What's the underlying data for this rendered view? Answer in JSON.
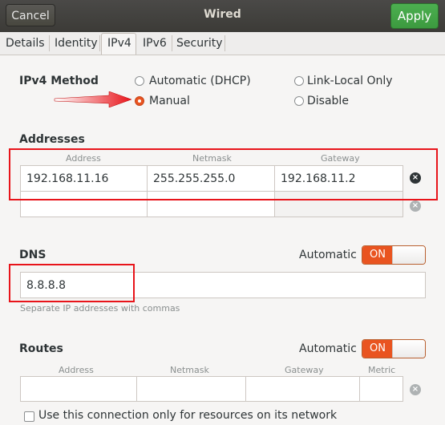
{
  "window": {
    "title": "Wired",
    "cancel_label": "Cancel",
    "apply_label": "Apply"
  },
  "tabs": [
    {
      "label": "Details"
    },
    {
      "label": "Identity"
    },
    {
      "label": "IPv4"
    },
    {
      "label": "IPv6"
    },
    {
      "label": "Security"
    }
  ],
  "active_tab": "IPv4",
  "ipv4_method": {
    "label": "IPv4 Method",
    "options": [
      "Automatic (DHCP)",
      "Link-Local Only",
      "Manual",
      "Disable"
    ],
    "selected": "Manual"
  },
  "addresses": {
    "section_label": "Addresses",
    "columns": [
      "Address",
      "Netmask",
      "Gateway"
    ],
    "rows": [
      {
        "address": "192.168.11.16",
        "netmask": "255.255.255.0",
        "gateway": "192.168.11.2"
      },
      {
        "address": "",
        "netmask": "",
        "gateway": ""
      }
    ]
  },
  "dns": {
    "section_label": "DNS",
    "automatic_label": "Automatic",
    "toggle_label": "ON",
    "value": "8.8.8.8",
    "hint": "Separate IP addresses with commas"
  },
  "routes": {
    "section_label": "Routes",
    "automatic_label": "Automatic",
    "toggle_label": "ON",
    "columns": [
      "Address",
      "Netmask",
      "Gateway",
      "Metric"
    ],
    "rows": [
      {
        "address": "",
        "netmask": "",
        "gateway": "",
        "metric": ""
      }
    ]
  },
  "only_resources_label": "Use this connection only for resources on its network",
  "colors": {
    "accent": "#e95420",
    "apply_green": "#3c9a3f",
    "annotation_red": "#e8141a"
  }
}
